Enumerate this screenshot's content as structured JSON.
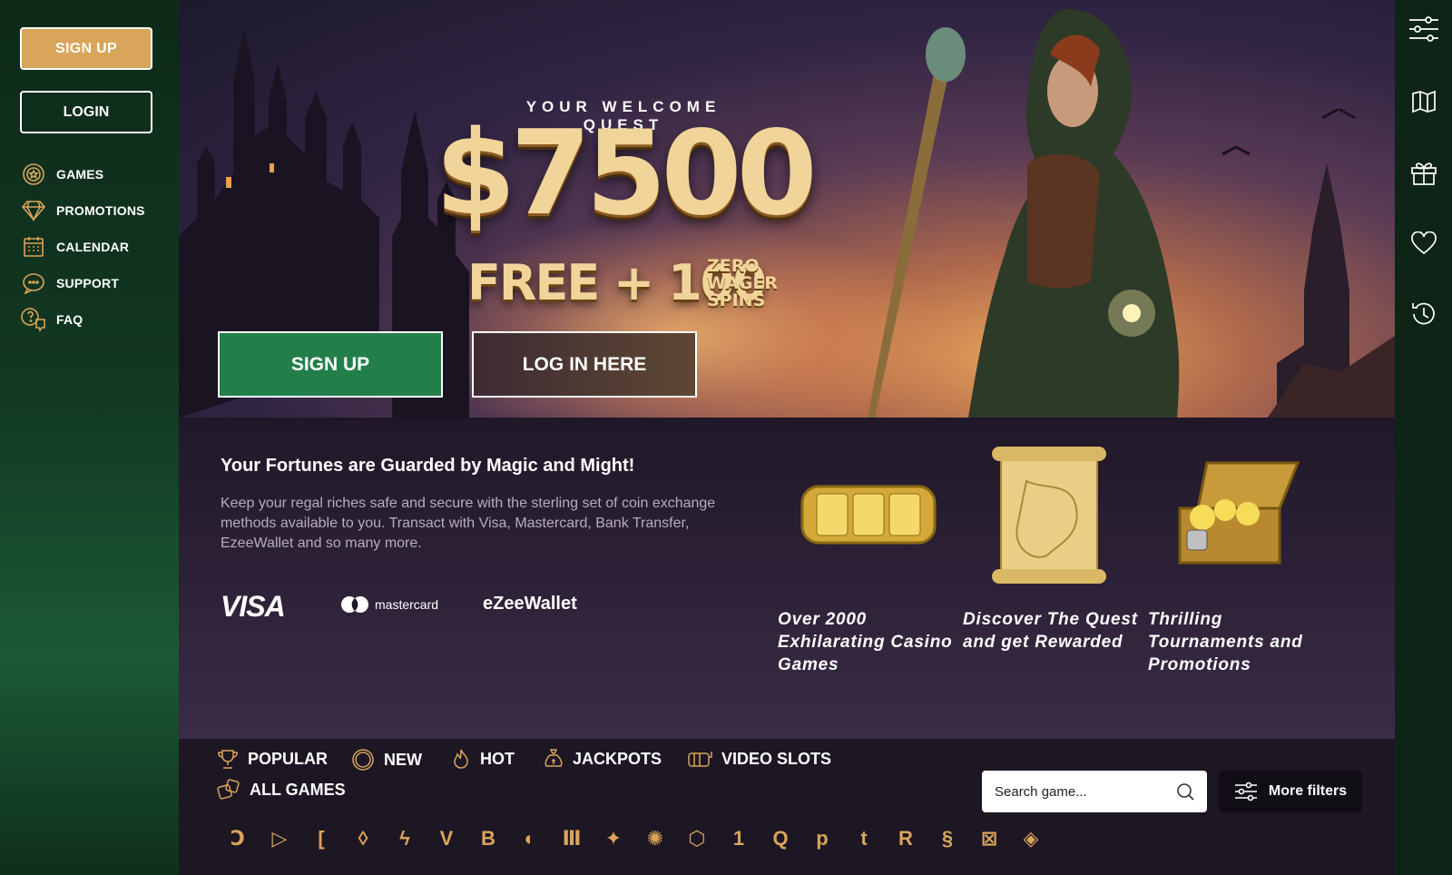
{
  "sidebar": {
    "signup_label": "SIGN UP",
    "login_label": "LOGIN",
    "nav": [
      {
        "label": "GAMES",
        "icon": "games-icon"
      },
      {
        "label": "PROMOTIONS",
        "icon": "diamond-icon"
      },
      {
        "label": "CALENDAR",
        "icon": "calendar-icon"
      },
      {
        "label": "SUPPORT",
        "icon": "chat-icon"
      },
      {
        "label": "FAQ",
        "icon": "faq-icon"
      }
    ]
  },
  "rightbar": {
    "icons": [
      "settings-sliders-icon",
      "map-icon",
      "gift-icon",
      "heart-icon",
      "history-icon"
    ]
  },
  "hero": {
    "kicker": "YOUR WELCOME QUEST",
    "amount": "$7500",
    "free": "FREE + 100",
    "zero_wager": [
      "ZERO",
      "WAGER",
      "SPINS"
    ],
    "signup_label": "SIGN UP",
    "login_label": "LOG IN HERE"
  },
  "info": {
    "title": "Your Fortunes are Guarded by Magic and Might!",
    "text": "Keep your regal riches safe and secure with the sterling set of coin exchange methods available to you. Transact with Visa, Mastercard, Bank Transfer, EzeeWallet and so many more.",
    "payments": [
      "VISA",
      "mastercard",
      "eZeeWallet"
    ],
    "features": [
      "Over 2000 Exhilarating Casino Games",
      "Discover The Quest and get Rewarded",
      "Thrilling Tournaments and Promotions"
    ]
  },
  "filters": {
    "categories": [
      {
        "label": "POPULAR",
        "icon": "trophy-icon"
      },
      {
        "label": "NEW",
        "icon": "new-badge-icon"
      },
      {
        "label": "HOT",
        "icon": "flame-icon"
      },
      {
        "label": "JACKPOTS",
        "icon": "money-bag-icon"
      },
      {
        "label": "VIDEO SLOTS",
        "icon": "slot-machine-icon"
      },
      {
        "label": "ALL GAMES",
        "icon": "dice-icon"
      }
    ],
    "search_placeholder": "Search game...",
    "more_filters_label": "More filters",
    "providers": [
      "Ↄ",
      "▷",
      "[",
      "◊",
      "ϟ",
      "V",
      "B",
      "◐",
      "Ⅲ",
      "✦",
      "✺",
      "⬡",
      "1",
      "Q",
      "p",
      "t",
      "R",
      "§",
      "⊠",
      "◈"
    ]
  },
  "colors": {
    "accent_gold": "#d9a55a",
    "sidebar_green": "#123822",
    "hero_green_button": "#237f4a"
  }
}
